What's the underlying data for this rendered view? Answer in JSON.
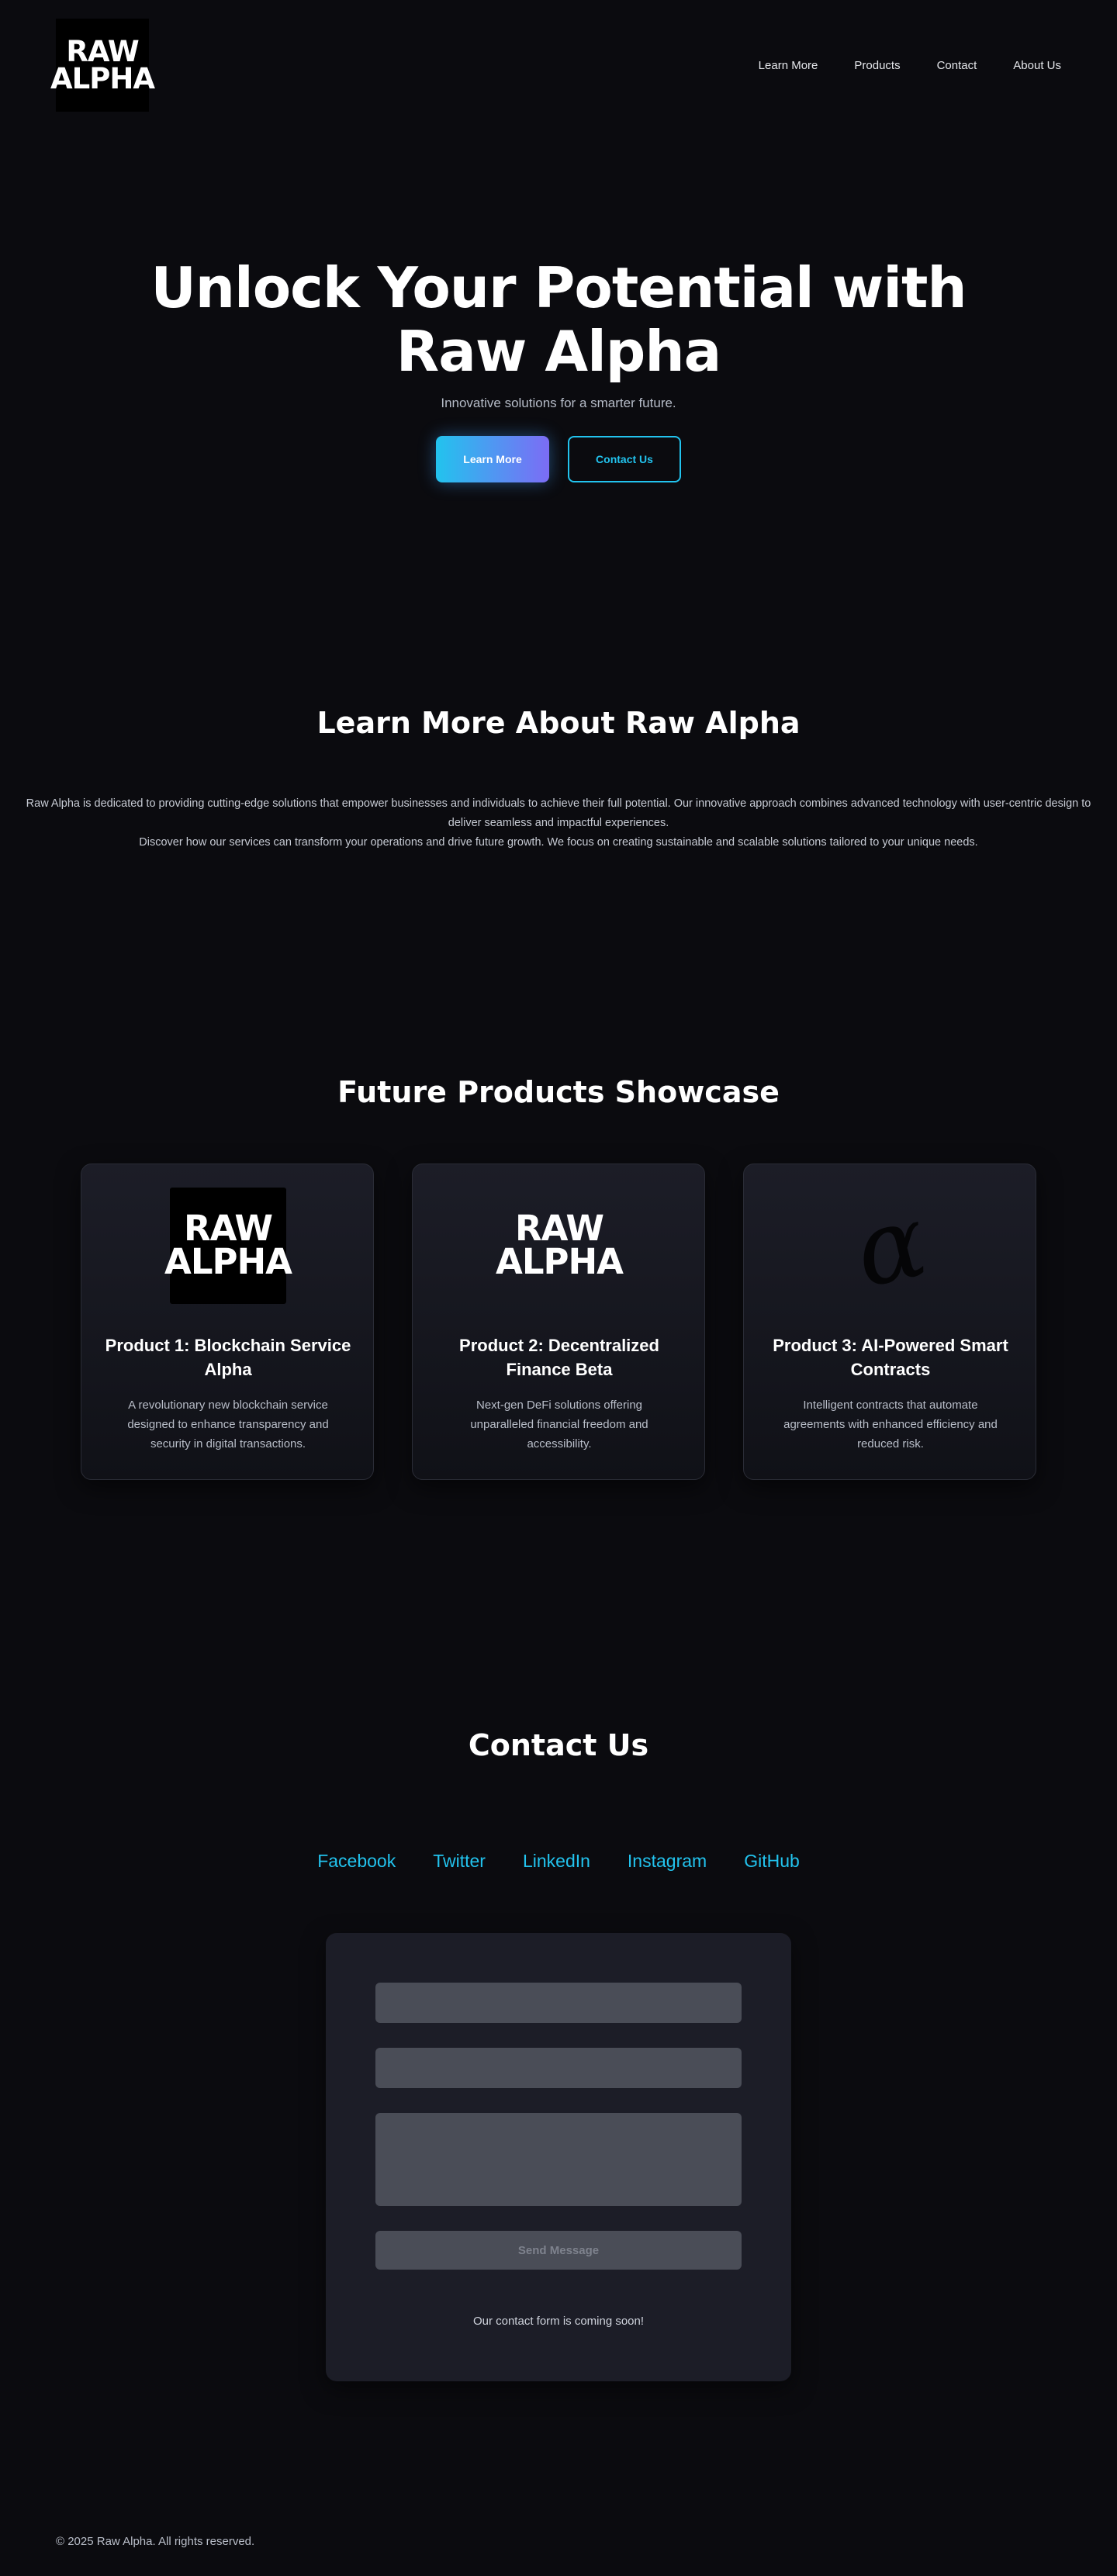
{
  "header": {
    "logo": {
      "line1": "RAW",
      "line2": "ALPHA"
    },
    "nav": [
      "Learn More",
      "Products",
      "Contact",
      "About Us"
    ]
  },
  "hero": {
    "title": "Unlock Your Potential with Raw Alpha",
    "subtitle": "Innovative solutions for a smarter future.",
    "primary_button": "Learn More",
    "secondary_button": "Contact Us"
  },
  "about": {
    "title": "Learn More About Raw Alpha",
    "paragraph1": "Raw Alpha is dedicated to providing cutting-edge solutions that empower businesses and individuals to achieve their full potential. Our innovative approach combines advanced technology with user-centric design to deliver seamless and impactful experiences.",
    "paragraph2": "Discover how our services can transform your operations and drive future growth. We focus on creating sustainable and scalable solutions tailored to your unique needs."
  },
  "products": {
    "title": "Future Products Showcase",
    "items": [
      {
        "title": "Product 1: Blockchain Service Alpha",
        "description": "A revolutionary new blockchain service designed to enhance transparency and security in digital transactions.",
        "image_line1": "RAW",
        "image_line2": "ALPHA"
      },
      {
        "title": "Product 2: Decentralized Finance Beta",
        "description": "Next-gen DeFi solutions offering unparalleled financial freedom and accessibility.",
        "image_line1": "RAW",
        "image_line2": "ALPHA"
      },
      {
        "title": "Product 3: AI-Powered Smart Contracts",
        "description": "Intelligent contracts that automate agreements with enhanced efficiency and reduced risk.",
        "image_glyph": "α"
      }
    ]
  },
  "contact": {
    "title": "Contact Us",
    "social": [
      "Facebook",
      "Twitter",
      "LinkedIn",
      "Instagram",
      "GitHub"
    ],
    "form": {
      "send_label": "Send Message",
      "note": "Our contact form is coming soon!"
    }
  },
  "footer": {
    "copyright": "© 2025 Raw Alpha. All rights reserved."
  },
  "colors": {
    "background": "#0b0b0f",
    "accent": "#22c3ee",
    "accent_gradient_end": "#7c6cf5",
    "card": "#1c1d27",
    "field": "#4a4d57"
  }
}
